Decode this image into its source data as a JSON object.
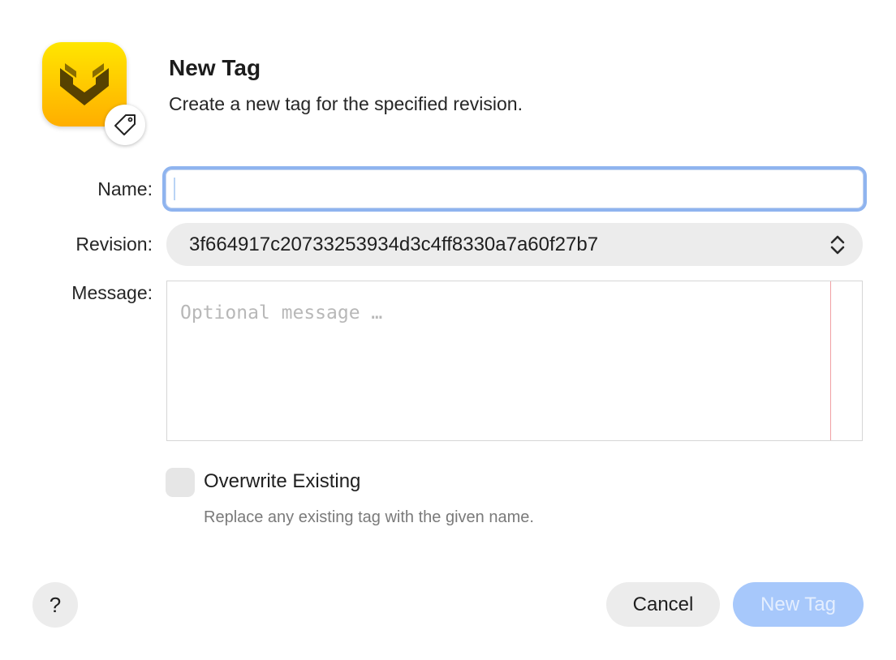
{
  "dialog": {
    "title": "New Tag",
    "subtitle": "Create a new tag for the specified revision."
  },
  "form": {
    "name_label": "Name:",
    "name_value": "",
    "revision_label": "Revision:",
    "revision_value": "3f664917c20733253934d3c4ff8330a7a60f27b7",
    "message_label": "Message:",
    "message_placeholder": "Optional message …",
    "overwrite_label": "Overwrite Existing",
    "overwrite_checked": false,
    "overwrite_help": "Replace any existing tag with the given name."
  },
  "buttons": {
    "help_label": "?",
    "cancel_label": "Cancel",
    "submit_label": "New Tag"
  },
  "icons": {
    "app_icon": "app-logo-icon",
    "badge_icon": "tag-icon",
    "select_icon": "chevron-up-down-icon"
  },
  "colors": {
    "accent": "#8fb4ef",
    "primary_button_disabled": "#a7c8fb",
    "app_icon_yellow": "#ffd200"
  }
}
